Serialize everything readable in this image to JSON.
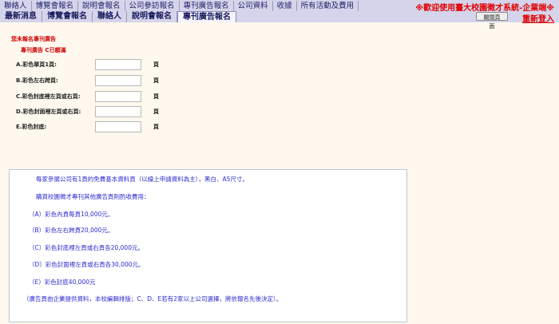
{
  "nav": {
    "top_items": [
      "聯絡人",
      "博覽會報名",
      "說明會報名",
      "公司參訪報名",
      "專刊廣告報名",
      "公司資料",
      "收據",
      "所有活動及費用"
    ],
    "tabs": [
      "最新消息",
      "博覽會報名",
      "聯絡人",
      "說明會報名",
      "專刊廣告報名"
    ],
    "active_tab": "專刊廣告報名"
  },
  "header": {
    "welcome": "※歡迎使用臺大校園徵才系統-企業端※",
    "close_button": "關閉頁面",
    "relogin": "重新登入"
  },
  "status": {
    "line1": "您未報名專刊廣告",
    "line2": "專刊廣告 C已額滿"
  },
  "form": {
    "unit": "頁",
    "rows": [
      {
        "label": "A.彩色單頁1頁:",
        "value": ""
      },
      {
        "label": "B.彩色左右跨頁:",
        "value": ""
      },
      {
        "label": "C.彩色封底裡左頁或右頁:",
        "value": ""
      },
      {
        "label": "D.彩色封面裡左頁或右頁:",
        "value": ""
      },
      {
        "label": "E.彩色封底:",
        "value": ""
      }
    ]
  },
  "info": {
    "lines": [
      "每家參展公司有1頁的免費基本資料頁（以線上申請資料為主），黑白、A5尺寸。",
      "購買校園徵才專刊其他廣告頁則酌收費用：",
      "（A）彩色內頁每頁10,000元。",
      "（B）彩色左右跨頁20,000元。",
      "（C）彩色封底裡左頁或右頁各20,000元。",
      "（D）彩色封面裡左頁或右頁各30,000元。",
      "（E）彩色封底40,000元",
      "（廣告頁由企業提供資料，本校編輯排版；C、D、E若有2家以上公司選擇，將依報名先後決定）。"
    ]
  }
}
